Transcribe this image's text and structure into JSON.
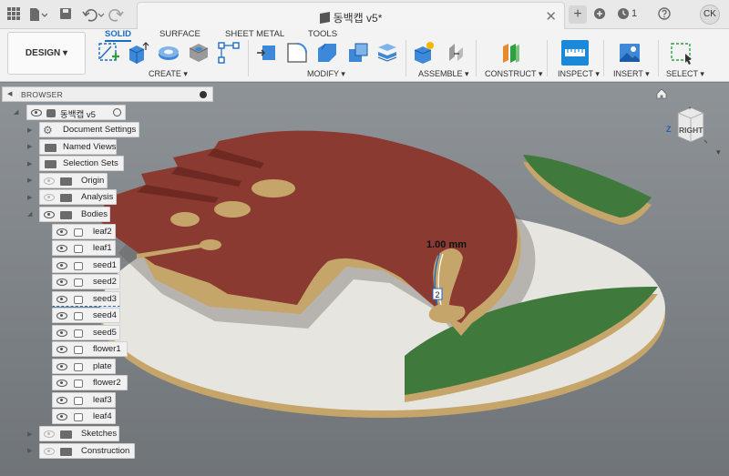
{
  "titlebar": {
    "document_title": "동백캡 v5*",
    "close_glyph": "✕",
    "add_tab_glyph": "+",
    "jobs_count": "1",
    "user_initials": "CK"
  },
  "workspace": {
    "label": "DESIGN ▾"
  },
  "tabs": [
    {
      "label": "SOLID",
      "active": true
    },
    {
      "label": "SURFACE",
      "active": false
    },
    {
      "label": "SHEET METAL",
      "active": false
    },
    {
      "label": "TOOLS",
      "active": false
    }
  ],
  "toolbar_groups": [
    {
      "label": "CREATE ▾"
    },
    {
      "label": "MODIFY ▾"
    },
    {
      "label": "ASSEMBLE ▾"
    },
    {
      "label": "CONSTRUCT ▾"
    },
    {
      "label": "INSPECT ▾"
    },
    {
      "label": "INSERT ▾"
    },
    {
      "label": "SELECT ▾"
    }
  ],
  "browser": {
    "title": "BROWSER",
    "root": "동백캡 v5",
    "items": [
      {
        "label": "Document Settings"
      },
      {
        "label": "Named Views"
      },
      {
        "label": "Selection Sets"
      },
      {
        "label": "Origin"
      },
      {
        "label": "Analysis"
      },
      {
        "label": "Bodies"
      },
      {
        "label": "Sketches"
      },
      {
        "label": "Construction"
      }
    ],
    "bodies": [
      {
        "label": "leaf2"
      },
      {
        "label": "leaf1"
      },
      {
        "label": "seed1"
      },
      {
        "label": "seed2"
      },
      {
        "label": "seed3"
      },
      {
        "label": "seed4"
      },
      {
        "label": "seed5"
      },
      {
        "label": "flower1"
      },
      {
        "label": "plate"
      },
      {
        "label": "flower2"
      },
      {
        "label": "leaf3"
      },
      {
        "label": "leaf4"
      }
    ]
  },
  "viewport": {
    "dimension_label": "1.00 mm",
    "dimension_badge": "2",
    "viewcube_label": "RIGHT",
    "viewcube_top": "+",
    "axis_label": "Z"
  },
  "colors": {
    "accent_blue": "#1a6bc4",
    "flower_red": "#8a3a30",
    "leaf_green": "#3f7a3c",
    "plate_white": "#e7e5e0",
    "wood": "#c9a96a"
  },
  "icons": [
    "grid-icon",
    "file-icon",
    "save-icon",
    "undo-icon",
    "redo-icon",
    "extensions-icon",
    "clock-icon",
    "home-icon",
    "eye-icon",
    "folder-icon",
    "gear-icon"
  ]
}
